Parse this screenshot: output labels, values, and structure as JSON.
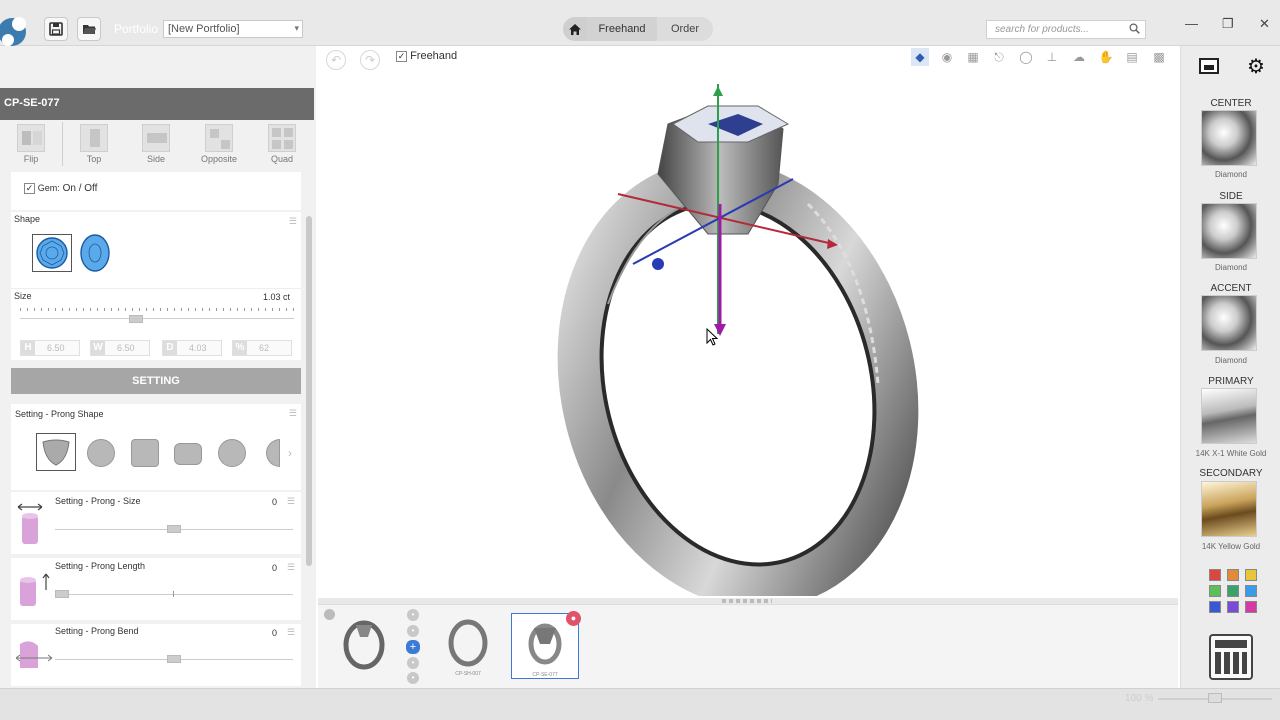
{
  "header": {
    "portfolio_label": "Portfolio",
    "portfolio_value": "[New Portfolio]",
    "mode_freehand": "Freehand",
    "mode_order": "Order",
    "search_placeholder": "search for products...",
    "icons": [
      "app-logo-icon",
      "save-icon",
      "open-folder-icon",
      "home-icon",
      "search-icon",
      "minimize-icon",
      "maximize-icon",
      "close-icon"
    ]
  },
  "left_panel": {
    "product_code": "CP-SE-077",
    "views": [
      {
        "label": "Flip"
      },
      {
        "label": "Top"
      },
      {
        "label": "Side"
      },
      {
        "label": "Opposite"
      },
      {
        "label": "Quad"
      }
    ],
    "gem_toggle": {
      "checked": true,
      "label_prefix": "Gem:",
      "label": "On / Off"
    },
    "shape_title": "Shape",
    "size_title": "Size",
    "size_value": "1.03 ct",
    "dims": [
      {
        "key": "H",
        "value": "6.50"
      },
      {
        "key": "W",
        "value": "6.50"
      },
      {
        "key": "D",
        "value": "4.03"
      },
      {
        "key": "%",
        "value": "62"
      }
    ],
    "setting_label": "SETTING",
    "prong_shape_title": "Setting - Prong Shape",
    "params": [
      {
        "label": "Setting - Prong - Size",
        "value": "0"
      },
      {
        "label": "Setting - Prong Length",
        "value": "0"
      },
      {
        "label": "Setting - Prong Bend",
        "value": "0"
      }
    ]
  },
  "canvas": {
    "freehand_checked": true,
    "freehand_label": "Freehand"
  },
  "thumbstrip": {
    "items": [
      {
        "caption": ""
      },
      {
        "caption": "CP-SH-007"
      },
      {
        "caption": "CP-SE-077"
      }
    ]
  },
  "right_panel": {
    "materials": [
      {
        "section": "CENTER",
        "caption": "Diamond"
      },
      {
        "section": "SIDE",
        "caption": "Diamond"
      },
      {
        "section": "ACCENT",
        "caption": "Diamond"
      },
      {
        "section": "PRIMARY",
        "caption": "14K X-1 White Gold"
      },
      {
        "section": "SECONDARY",
        "caption": "14K Yellow Gold"
      }
    ],
    "palette": [
      "#d9473f",
      "#e08a3a",
      "#e8c53a",
      "#5bbf5b",
      "#3aa36a",
      "#3a9be8",
      "#3a57d6",
      "#7a4bd6",
      "#d63aa5"
    ]
  },
  "status": {
    "zoom": "100 %"
  }
}
